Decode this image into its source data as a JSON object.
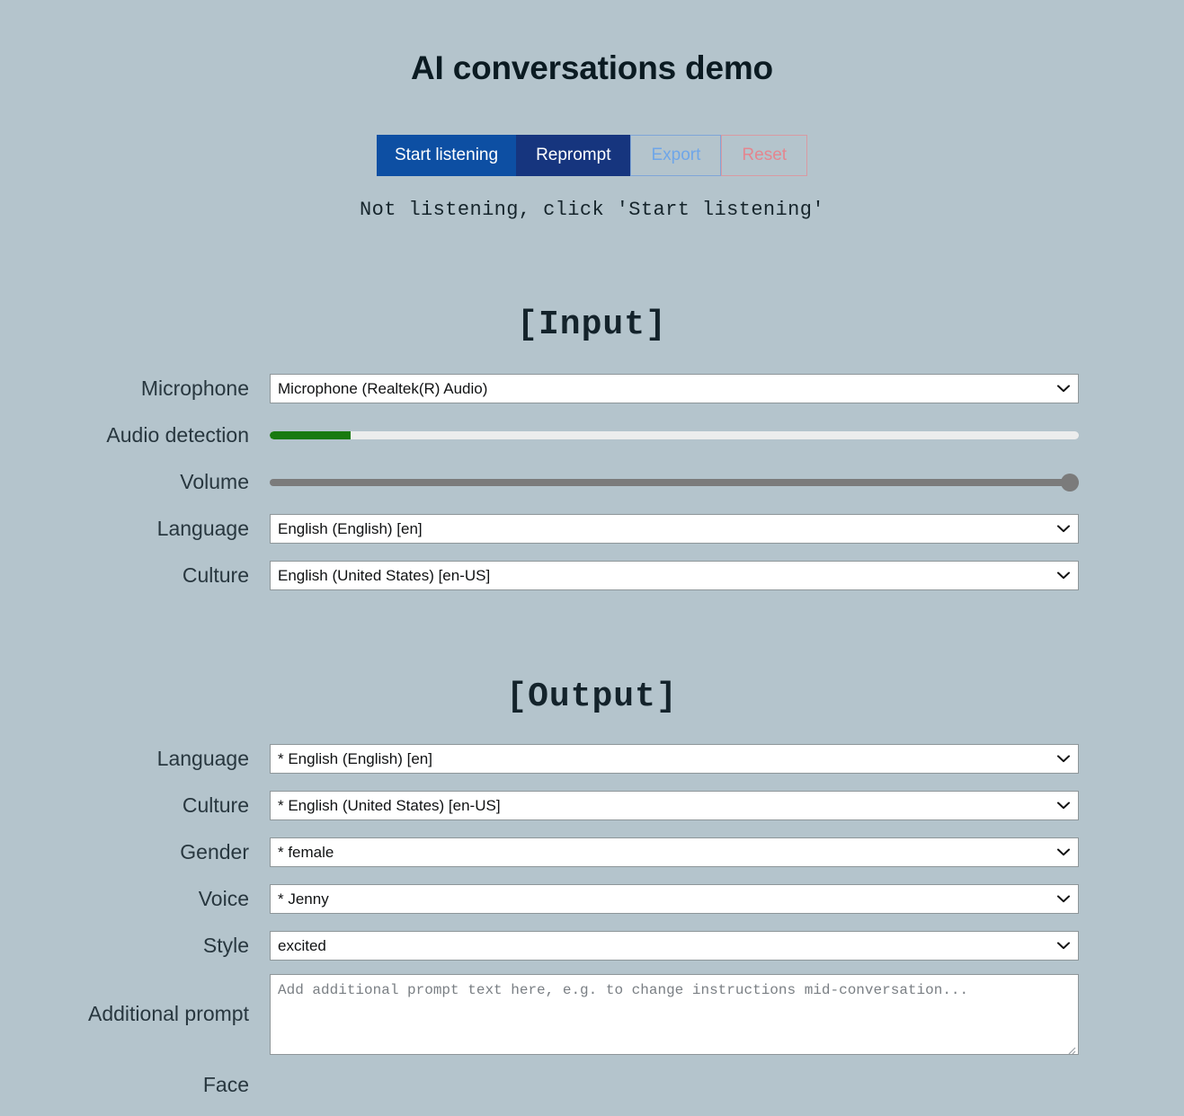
{
  "header": {
    "title": "AI conversations demo"
  },
  "toolbar": {
    "start_listening_label": "Start listening",
    "reprompt_label": "Reprompt",
    "export_label": "Export",
    "reset_label": "Reset"
  },
  "status": {
    "text": "Not listening, click 'Start listening'"
  },
  "input_section": {
    "heading": "[Input]",
    "microphone": {
      "label": "Microphone",
      "value": "Microphone (Realtek(R) Audio)"
    },
    "audio_detection": {
      "label": "Audio detection",
      "value_percent": 10
    },
    "volume": {
      "label": "Volume",
      "value_percent": 100
    },
    "language": {
      "label": "Language",
      "value": "English (English) [en]"
    },
    "culture": {
      "label": "Culture",
      "value": "English (United States) [en-US]"
    }
  },
  "output_section": {
    "heading": "[Output]",
    "language": {
      "label": "Language",
      "value": "* English (English) [en]"
    },
    "culture": {
      "label": "Culture",
      "value": "* English (United States) [en-US]"
    },
    "gender": {
      "label": "Gender",
      "value": "* female"
    },
    "voice": {
      "label": "Voice",
      "value": "* Jenny"
    },
    "style": {
      "label": "Style",
      "value": "excited"
    },
    "additional_prompt": {
      "label": "Additional prompt",
      "value": "",
      "placeholder": "Add additional prompt text here, e.g. to change instructions mid-conversation..."
    },
    "face": {
      "label": "Face"
    }
  },
  "icons": {
    "chevron_down": "chevron-down-icon",
    "resize_handle": "resize-handle-icon"
  },
  "colors": {
    "page_background": "#b4c4cc",
    "primary_button": "#0d4fa3",
    "secondary_button": "#16357e",
    "outline_primary_disabled_text": "#6fa6e8",
    "outline_danger_disabled_text": "#e4868f",
    "progress_fill": "#197a10",
    "slider": "#7b7b7b",
    "label_text": "#28373f"
  }
}
